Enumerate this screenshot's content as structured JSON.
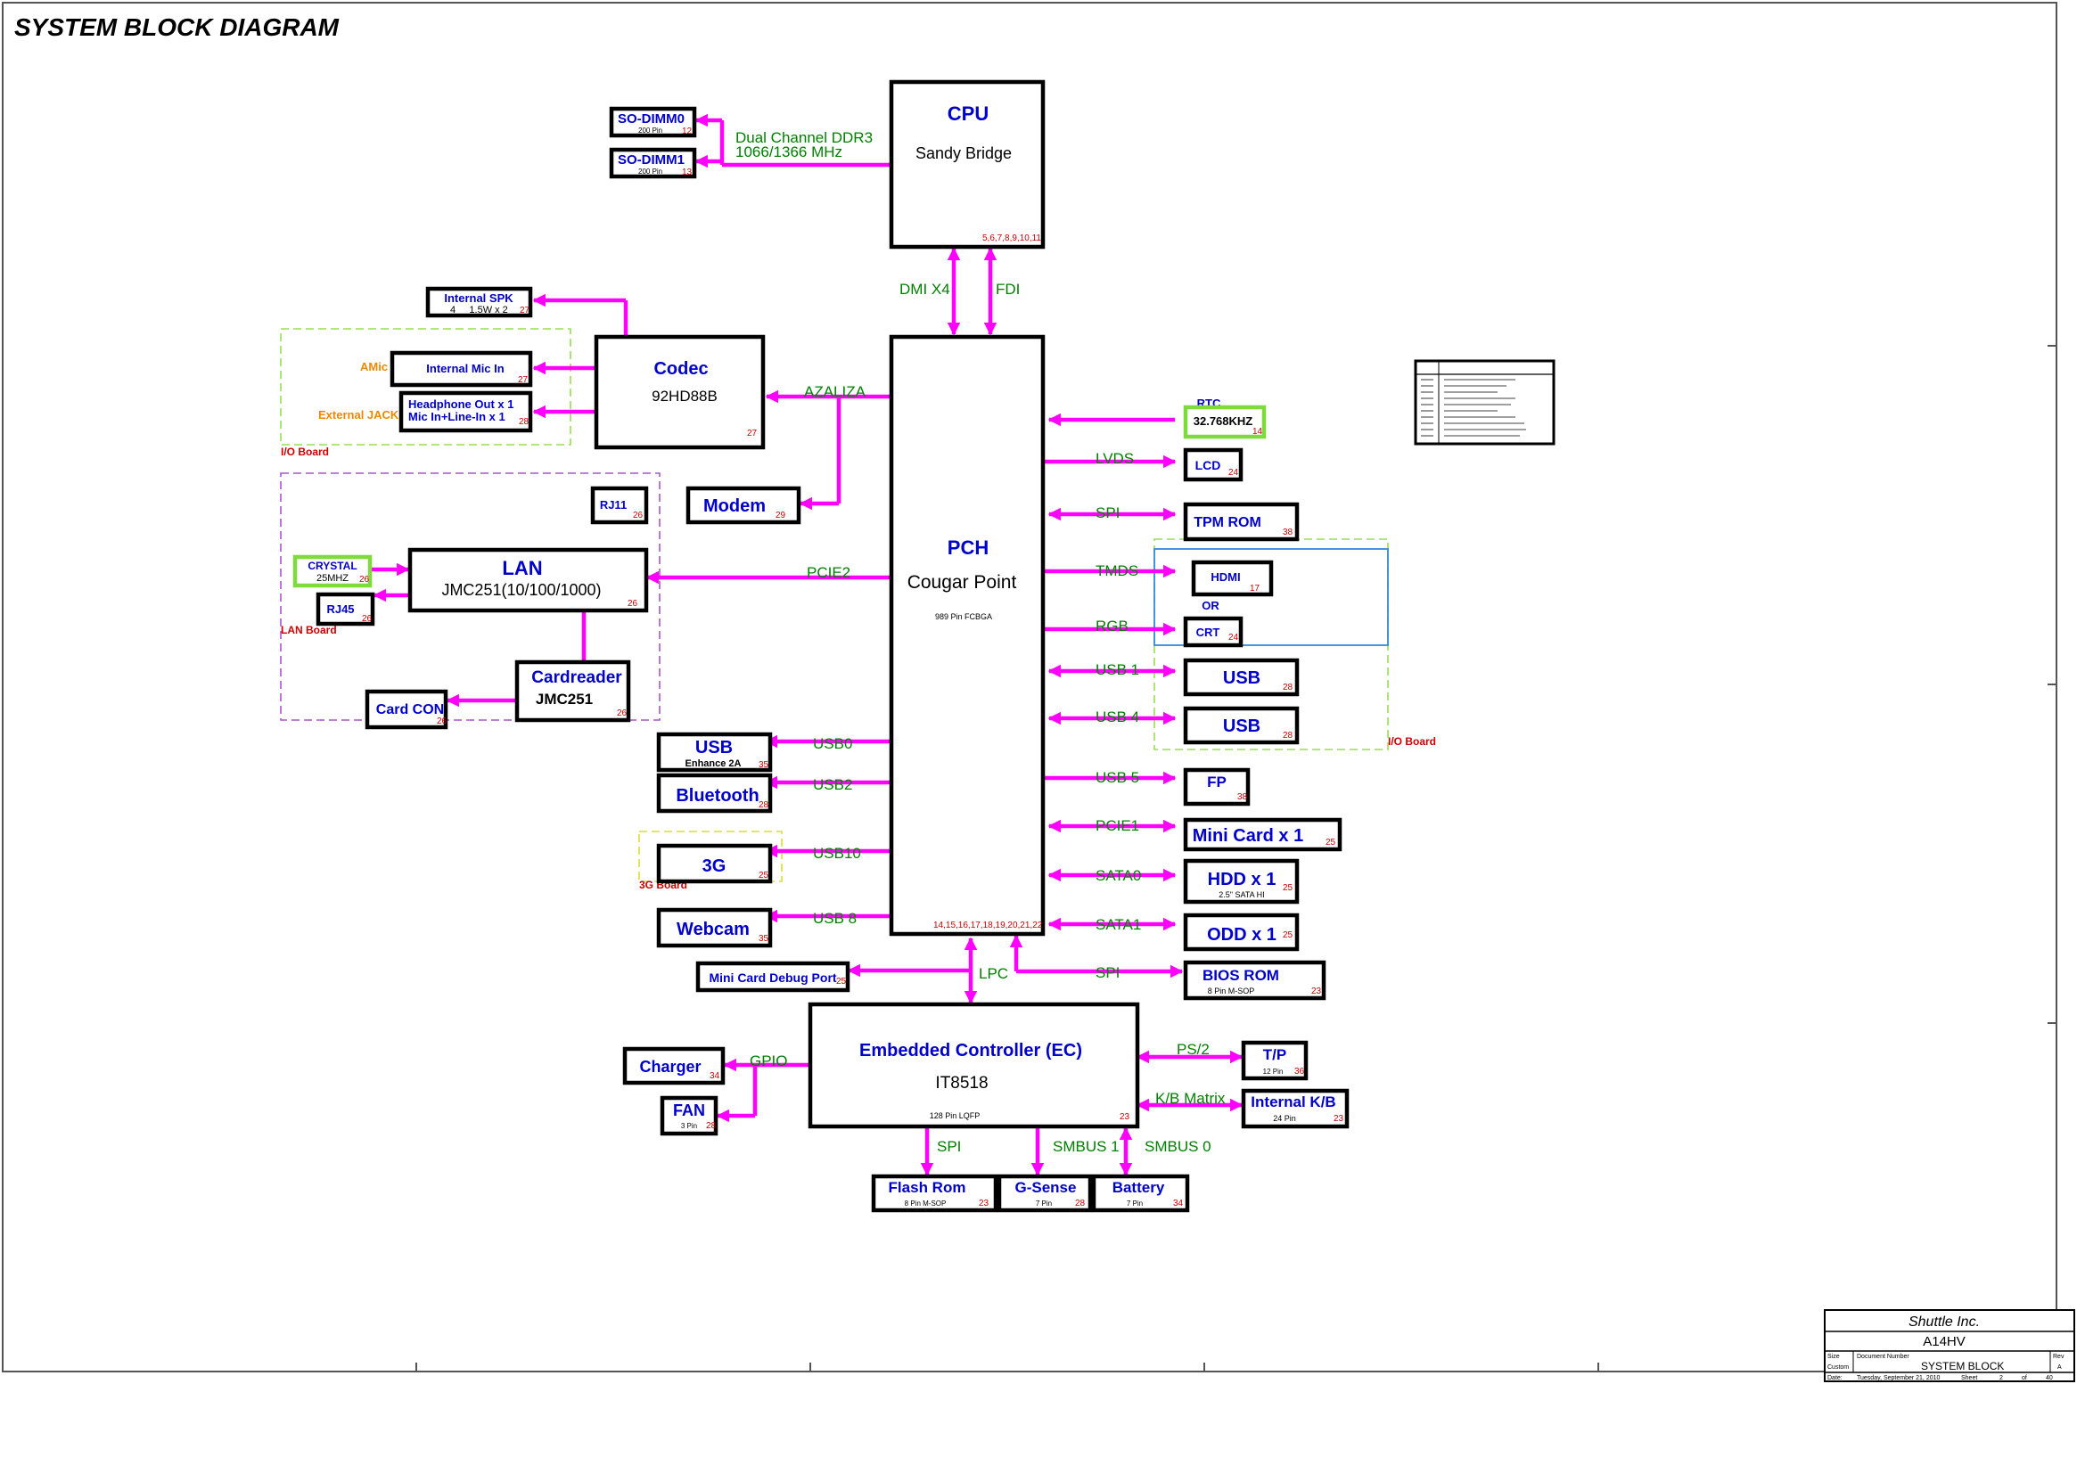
{
  "title": "SYSTEM BLOCK DIAGRAM",
  "cpu": {
    "label": "CPU",
    "sub": "Sandy Bridge",
    "pages": "5,6,7,8,9,10,11"
  },
  "memory": {
    "dimm0": {
      "label": "SO-DIMM0",
      "pins": "200 Pin",
      "page": "12"
    },
    "dimm1": {
      "label": "SO-DIMM1",
      "pins": "200 Pin",
      "page": "13"
    },
    "bus1": "Dual Channel DDR3",
    "bus2": "1066/1366 MHz"
  },
  "cpu_links": {
    "dmi": "DMI X4",
    "fdi": "FDI"
  },
  "pch": {
    "label": "PCH",
    "sub": "Cougar Point",
    "pkg": "989 Pin FCBGA",
    "pages": "14,15,16,17,18,19,20,21,22"
  },
  "codec": {
    "label": "Codec",
    "sub": "92HD88B",
    "page": "27",
    "bus": "AZALIZA"
  },
  "audio": {
    "spk_label": "Internal SPK",
    "spk_spec": "4     1.5W x 2",
    "spk_page": "27",
    "mic_label": "Internal Mic In",
    "mic_page": "27",
    "hp_label1": "Headphone Out x 1",
    "hp_label2": "Mic In+Line-In x 1",
    "hp_page": "28",
    "amic": "AMic",
    "ext_jack": "External JACK",
    "io_board": "I/O Board"
  },
  "modem": {
    "label": "Modem",
    "page": "29",
    "rj11": "RJ11",
    "rj11_page": "26"
  },
  "lan": {
    "label": "LAN",
    "sub": "JMC251(10/100/1000)",
    "page": "26",
    "bus": "PCIE2",
    "crystal": "CRYSTAL",
    "crystal_freq": "25MHZ",
    "crystal_page": "26",
    "rj45": "RJ45",
    "rj45_page": "26",
    "board": "LAN Board"
  },
  "cardreader": {
    "label": "Cardreader",
    "sub": "JMC251",
    "page": "26",
    "con": "Card CON",
    "con_page": "26"
  },
  "left_usb": [
    {
      "label": "USB",
      "sub": "Enhance 2A",
      "page": "35",
      "bus": "USB0"
    },
    {
      "label": "Bluetooth",
      "sub": "",
      "page": "28",
      "bus": "USB2"
    },
    {
      "label": "3G",
      "sub": "",
      "page": "25",
      "bus": "USB10"
    },
    {
      "label": "Webcam",
      "sub": "",
      "page": "35",
      "bus": "USB 8"
    }
  ],
  "g3_board": "3G Board",
  "rtc": {
    "label": "RTC",
    "freq": "32.768KHZ",
    "page": "14"
  },
  "right_links": [
    {
      "bus": "LVDS",
      "label": "LCD",
      "page": "24"
    },
    {
      "bus": "SPI",
      "label": "TPM ROM",
      "page": "38"
    },
    {
      "bus": "TMDS",
      "label": "HDMI",
      "page": "17"
    },
    {
      "bus": "RGB",
      "label": "CRT",
      "page": "24"
    },
    {
      "bus": "USB 1",
      "label": "USB",
      "page": "28"
    },
    {
      "bus": "USB 4",
      "label": "USB",
      "page": "28"
    },
    {
      "bus": "USB 5",
      "label": "FP",
      "page": "38"
    },
    {
      "bus": "PCIE1",
      "label": "Mini Card x 1",
      "page": "25"
    },
    {
      "bus": "SATA0",
      "label": "HDD x 1",
      "sub": "2.5\" SATA HI",
      "page": "25"
    },
    {
      "bus": "SATA1",
      "label": "ODD x 1",
      "page": "25"
    },
    {
      "bus": "SPI",
      "label": "BIOS ROM",
      "sub": "8 Pin M-SOP",
      "page": "23"
    }
  ],
  "or_text": "OR",
  "right_io_board": "I/O Board",
  "lpc": "LPC",
  "debug": {
    "label": "Mini Card Debug Port",
    "page": "25"
  },
  "ec": {
    "label": "Embedded Controller (EC)",
    "sub": "IT8518",
    "pkg": "128 Pin LQFP",
    "page": "23"
  },
  "ec_left": {
    "bus": "GPIO",
    "charger": "Charger",
    "charger_page": "34",
    "fan": "FAN",
    "fan_sub": "3 Pin",
    "fan_page": "28"
  },
  "ec_right": [
    {
      "bus": "PS/2",
      "label": "T/P",
      "sub": "12 Pin",
      "page": "36"
    },
    {
      "bus": "K/B Matrix",
      "label": "Internal K/B",
      "sub": "24 Pin",
      "page": "23"
    }
  ],
  "ec_bottom": [
    {
      "bus": "SPI",
      "label": "Flash Rom",
      "sub": "8 Pin M-SOP",
      "page": "23"
    },
    {
      "bus": "SMBUS 1",
      "label": "G-Sense",
      "sub": "7 Pin",
      "page": "28"
    },
    {
      "bus": "SMBUS 0",
      "label": "Battery",
      "sub": "7 Pin",
      "page": "34"
    }
  ],
  "titleblock": {
    "company": "Shuttle Inc.",
    "model": "A14HV",
    "size_label": "Size",
    "docnum_label": "Document Number",
    "rev_label": "Rev",
    "size": "Custom",
    "doc": "SYSTEM BLOCK",
    "rev": "A",
    "date_label": "Date:",
    "date": "Tuesday, September 21, 2010",
    "sheet_label": "Sheet",
    "sheet": "2",
    "of_label": "of",
    "total": "40"
  }
}
